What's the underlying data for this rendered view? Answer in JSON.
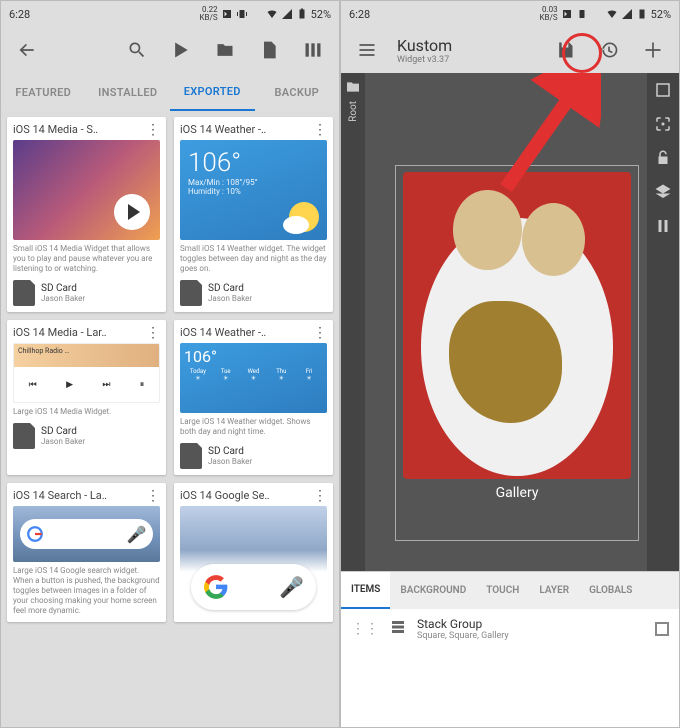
{
  "status": {
    "time": "6:28",
    "kbs_val": "0.22",
    "kbs_unit": "KB/S",
    "kbs_val2": "0.03",
    "battery": "52%"
  },
  "left": {
    "tabs": [
      "FEATURED",
      "INSTALLED",
      "EXPORTED",
      "BACKUP"
    ],
    "active_tab": "EXPORTED",
    "cards": [
      {
        "title": "iOS 14 Media - S‥",
        "desc": "Small iOS 14 Media Widget that allows you to play and pause whatever you are listening to or watching.",
        "loc": "SD Card",
        "author": "Jason Baker"
      },
      {
        "title": "iOS 14 Weather -‥",
        "desc": "Small iOS 14 Weather widget. The widget toggles between day and night as the day goes on.",
        "loc": "SD Card",
        "author": "Jason Baker"
      },
      {
        "title": "iOS 14 Media - Lar‥",
        "desc": "Large iOS 14 Media Widget.",
        "loc": "SD Card",
        "author": "Jason Baker"
      },
      {
        "title": "iOS 14 Weather -‥",
        "desc": "Large iOS 14 Weather widget. Shows both day and night time.",
        "loc": "SD Card",
        "author": "Jason Baker"
      },
      {
        "title": "iOS 14 Search - La‥",
        "desc": "Large iOS 14 Google search widget. When a button is pushed, the background toggles between images in a folder of your choosing making your home screen feel more dynamic.",
        "loc": "",
        "author": ""
      },
      {
        "title": "iOS 14 Google Se‥",
        "desc": "",
        "loc": "",
        "author": ""
      }
    ],
    "weather": {
      "temp": "106°",
      "maxmin": "Max/Min : 108°/95°",
      "humidity": "Humidity : 10%"
    },
    "weather2_temp": "106°",
    "chillhop": "Chillhop Radio …"
  },
  "right": {
    "title": "Kustom",
    "subtitle": "Widget v3.37",
    "vtab": "Root",
    "gallery_label": "Gallery",
    "btabs": [
      "ITEMS",
      "BACKGROUND",
      "TOUCH",
      "LAYER",
      "GLOBALS"
    ],
    "active_btab": "ITEMS",
    "layer": {
      "name": "Stack Group",
      "detail": "Square, Square, Gallery"
    }
  }
}
